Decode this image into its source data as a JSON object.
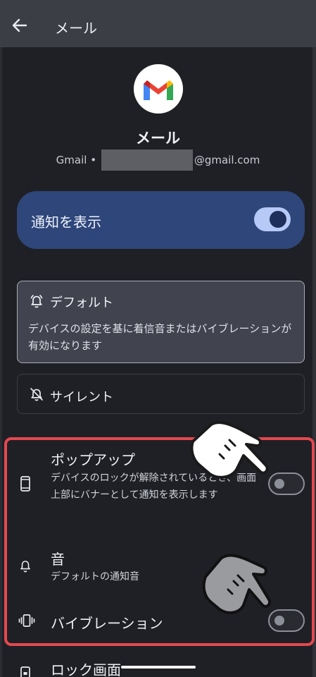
{
  "appbar": {
    "title": "メール"
  },
  "header": {
    "app_name": "メール",
    "account_prefix": "Gmail •",
    "account_suffix": "@gmail.com"
  },
  "master": {
    "label": "通知を表示",
    "enabled": true
  },
  "options": {
    "default": {
      "title": "デフォルト",
      "description": "デバイスの設定を基に着信音またはバイブレーションが有効になります",
      "selected": true
    },
    "silent": {
      "title": "サイレント",
      "selected": false
    }
  },
  "rows": {
    "popup": {
      "title": "ポップアップ",
      "description": "デバイスのロックが解除されているとき、画面上部にバナーとして通知を表示します",
      "enabled": false
    },
    "sound": {
      "title": "音",
      "description": "デフォルトの通知音"
    },
    "vibration": {
      "title": "バイブレーション",
      "enabled": false
    },
    "lockscreen": {
      "title": "ロック画面"
    }
  },
  "icons": {
    "back": "arrow-left-icon",
    "alarm": "bell-alarm-icon",
    "silent": "bell-off-icon",
    "popup": "phone-icon",
    "sound": "bell-icon",
    "vibration": "vibrate-icon",
    "lock": "lock-phone-icon"
  },
  "colors": {
    "accent": "#2e4679",
    "toggle_on": "#b7c9f7",
    "highlight": "#e5484f"
  }
}
